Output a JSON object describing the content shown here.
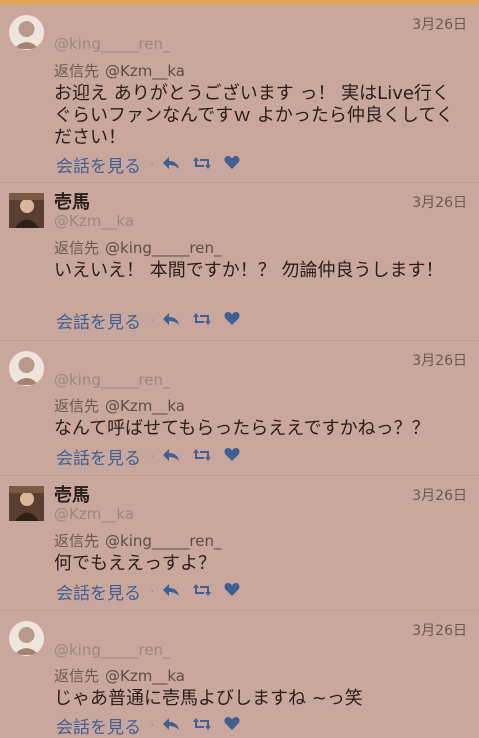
{
  "tweets": [
    {
      "handle": "@king_____ren_",
      "date": "3月26日",
      "reply_label": "返信先",
      "reply_to": "@Kzm__ka",
      "text": "お迎え ありがとうございます っ！ 実はLive行くぐらいファンなんですｗ よかったら仲良くしてください！",
      "conv_label": "会話を見る",
      "avatar_icon": "user-avatar-icon"
    },
    {
      "name": "壱馬",
      "handle": "@Kzm__ka",
      "date": "3月26日",
      "reply_label": "返信先",
      "reply_to": "@king_____ren_",
      "text": "いえいえ！ 本間ですか！？ 勿論仲良うします！",
      "conv_label": "会話を見る",
      "avatar_icon": "user-avatar-icon"
    },
    {
      "handle": "@king_____ren_",
      "date": "3月26日",
      "reply_label": "返信先",
      "reply_to": "@Kzm__ka",
      "text": "なんて呼ばせてもらったらええですかねっ？？",
      "conv_label": "会話を見る",
      "avatar_icon": "user-avatar-icon"
    },
    {
      "name": "壱馬",
      "handle": "@Kzm__ka",
      "date": "3月26日",
      "reply_label": "返信先",
      "reply_to": "@king_____ren_",
      "text": "何でもええっすよ？",
      "conv_label": "会話を見る",
      "avatar_icon": "user-avatar-icon"
    },
    {
      "handle": "@king_____ren_",
      "date": "3月26日",
      "reply_label": "返信先",
      "reply_to": "@Kzm__ka",
      "text": "じゃあ普通に壱馬よびしますね ~っ笑",
      "conv_label": "会話を見る",
      "avatar_icon": "user-avatar-icon"
    }
  ],
  "colors": {
    "accent": "#405f95",
    "topbar": "#e3a35a",
    "background": "#c9a79c"
  }
}
